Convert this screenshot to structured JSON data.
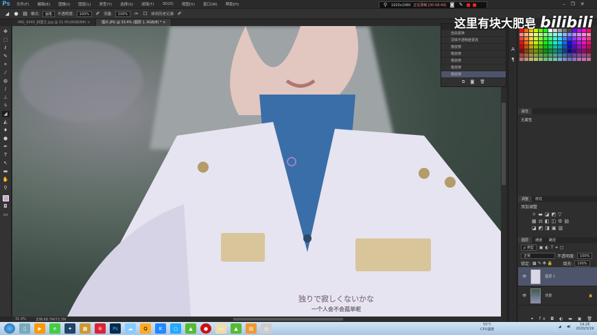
{
  "app": {
    "logo": "Ps",
    "menu": [
      "文件(F)",
      "编辑(E)",
      "图像(I)",
      "图层(L)",
      "类型(Y)",
      "选择(S)",
      "滤镜(T)",
      "3D(D)",
      "视图(V)",
      "窗口(W)",
      "帮助(H)"
    ]
  },
  "options": {
    "mode_label": "模式:",
    "mode_value": "画笔",
    "opacity_label": "不透明度:",
    "opacity_value": "100%",
    "flow_label": "流量:",
    "flow_value": "100%",
    "erase_history_label": "抹到历史记录"
  },
  "tabs": [
    {
      "label": "IMG_9345_斜图王.jpg @ 31.9%(RGB/8#) ×"
    },
    {
      "label": "图片.JPG @ 33.4% (图层 1, RGB/8) * ×"
    }
  ],
  "recorder": {
    "resolution": "1920x1080",
    "status": "正在录制 [00:08:49]"
  },
  "watermark": {
    "text": "这里有块大肥皂",
    "brand": "bilibili"
  },
  "history": {
    "items": [
      "自由变换",
      "羽体不透明度更改",
      "橡皮擦",
      "橡皮擦",
      "橡皮擦",
      "橡皮擦",
      "橡皮擦"
    ],
    "selected": 6
  },
  "properties": {
    "title": "属性",
    "empty": "无属性"
  },
  "adjustments": {
    "tabs": [
      "调整",
      "样式"
    ],
    "add_label": "添加调整"
  },
  "layers": {
    "tabs": [
      "图层",
      "通道",
      "路径"
    ],
    "filter": "ρ 类型",
    "blend": "正常",
    "opacity_label": "不透明度:",
    "opacity_value": "100%",
    "lock_label": "锁定:",
    "fill_label": "填充:",
    "fill_value": "100%",
    "items": [
      {
        "name": "图层 1",
        "selected": true
      },
      {
        "name": "背景",
        "locked": true
      }
    ]
  },
  "status": {
    "zoom": "31.4%",
    "doc": "文档:68.7M/73.7M"
  },
  "subtitle": {
    "jp": "独りで寂しくないかな",
    "cn": "一个人会不会孤单呢"
  },
  "taskbar": {
    "cpu_temp": "50°C",
    "cpu_label": "CPU温度",
    "time": "19:26",
    "date": "2020/3/19"
  }
}
